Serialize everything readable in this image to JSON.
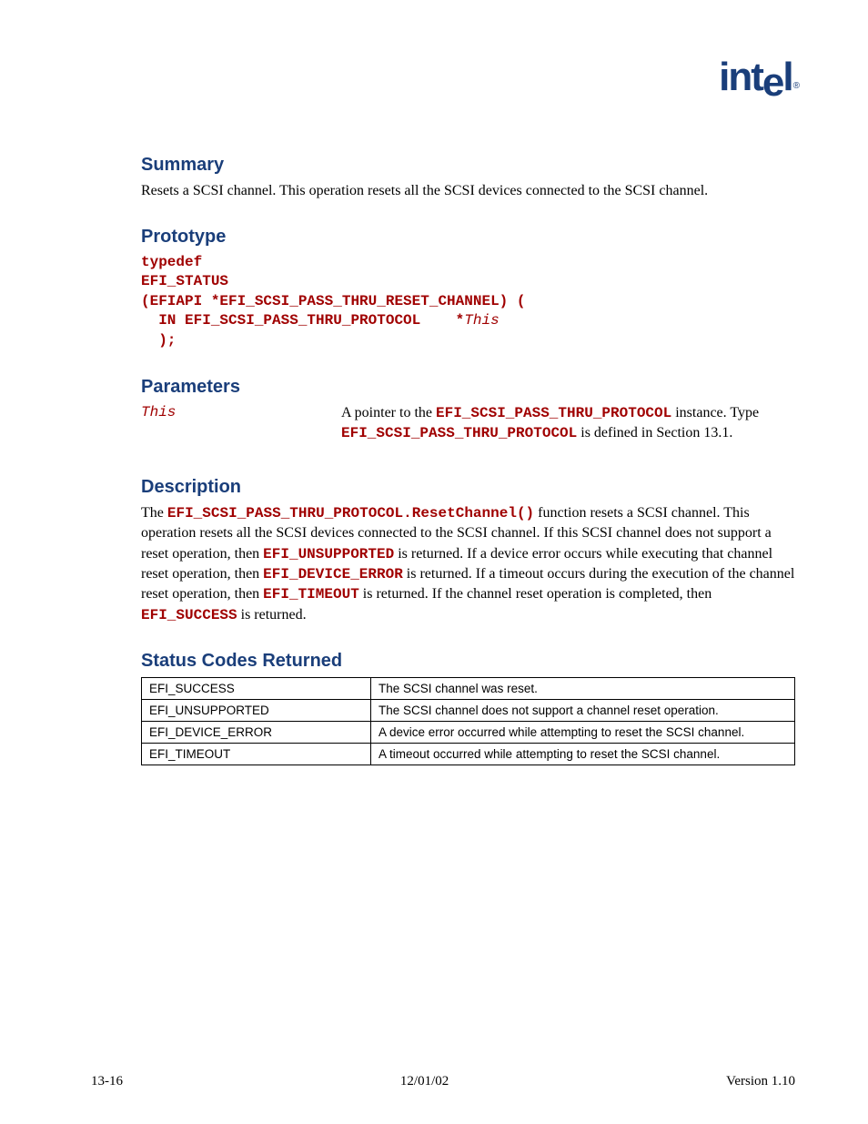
{
  "logo_text": "intel",
  "headings": {
    "summary": "Summary",
    "prototype": "Prototype",
    "parameters": "Parameters",
    "description": "Description",
    "status_codes": "Status Codes Returned"
  },
  "summary_text": "Resets a SCSI channel.  This operation resets all the SCSI devices connected to the SCSI channel.",
  "prototype": {
    "line1": "typedef",
    "line2": "EFI_STATUS",
    "line3": "(EFIAPI *EFI_SCSI_PASS_THRU_RESET_CHANNEL) (",
    "line4a": "  IN EFI_SCSI_PASS_THRU_PROTOCOL    *",
    "line4b": "This",
    "line5": "  );"
  },
  "parameters": [
    {
      "name": "This",
      "desc_pre": "A pointer to the ",
      "desc_code1": "EFI_SCSI_PASS_THRU_PROTOCOL",
      "desc_mid": " instance.  Type ",
      "desc_code2": "EFI_SCSI_PASS_THRU_PROTOCOL",
      "desc_post": " is defined in Section 13.1."
    }
  ],
  "description": {
    "t1": "The ",
    "c1": "EFI_SCSI_PASS_THRU_PROTOCOL.ResetChannel()",
    "t2": " function resets a SCSI channel. This operation resets all the SCSI devices connected to the SCSI channel.  If this SCSI channel does not support a reset operation, then ",
    "c2": "EFI_UNSUPPORTED",
    "t3": " is returned.  If a device error occurs while executing that channel reset operation, then ",
    "c3": "EFI_DEVICE_ERROR",
    "t4": " is returned.  If a timeout occurs during the execution of the channel reset operation, then ",
    "c4": "EFI_TIMEOUT",
    "t5": " is returned.  If the channel reset operation is completed, then ",
    "c5": "EFI_SUCCESS",
    "t6": " is returned."
  },
  "status_table": [
    {
      "code": "EFI_SUCCESS",
      "desc": "The SCSI channel was reset."
    },
    {
      "code": "EFI_UNSUPPORTED",
      "desc": "The SCSI channel does not support a channel reset operation."
    },
    {
      "code": "EFI_DEVICE_ERROR",
      "desc": "A device error occurred while attempting to reset the SCSI channel."
    },
    {
      "code": "EFI_TIMEOUT",
      "desc": "A timeout occurred while attempting to reset the SCSI channel."
    }
  ],
  "footer": {
    "left": "13-16",
    "center": "12/01/02",
    "right": "Version 1.10"
  }
}
